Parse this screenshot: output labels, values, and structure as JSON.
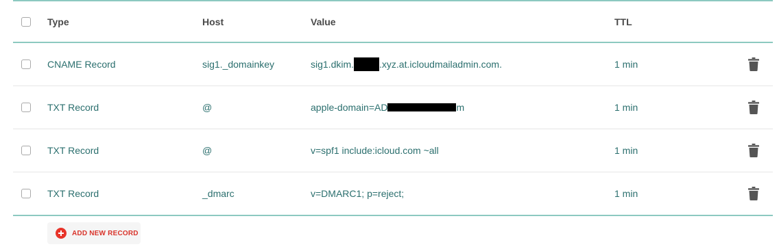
{
  "table": {
    "columns": {
      "type": "Type",
      "host": "Host",
      "value": "Value",
      "ttl": "TTL"
    },
    "rows": [
      {
        "type": "CNAME Record",
        "host": "sig1._domainkey",
        "value_prefix": "sig1.dkim.",
        "value_suffix": ".xyz.at.icloudmailadmin.com.",
        "redacted": true,
        "ttl": "1 min"
      },
      {
        "type": "TXT Record",
        "host": "@",
        "value_prefix": "apple-domain=AD",
        "value_suffix": "m",
        "redacted": true,
        "ttl": "1 min"
      },
      {
        "type": "TXT Record",
        "host": "@",
        "value": "v=spf1 include:icloud.com ~all",
        "ttl": "1 min"
      },
      {
        "type": "TXT Record",
        "host": "_dmarc",
        "value": "v=DMARC1; p=reject;",
        "ttl": "1 min"
      }
    ]
  },
  "actions": {
    "add_new_record": "ADD NEW RECORD"
  },
  "colors": {
    "accent_line": "#8cc9c0",
    "text_teal": "#2b6f6e",
    "add_red": "#e8342a"
  },
  "icons": {
    "row_delete": "trash-icon",
    "add": "plus-circle-icon"
  }
}
